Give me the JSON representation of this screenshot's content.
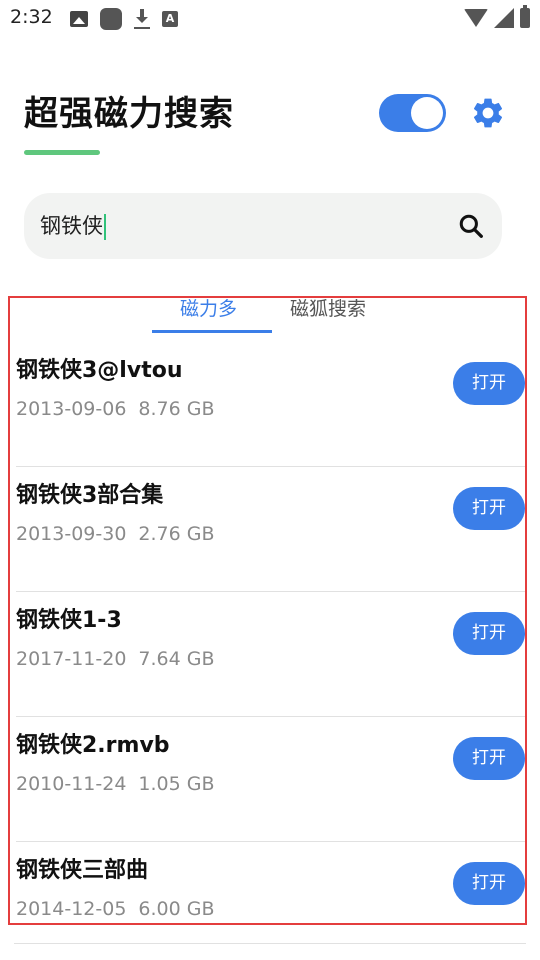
{
  "status_bar": {
    "time": "2:32",
    "left_icons": [
      "image-icon",
      "app-icon",
      "download-icon",
      "a-icon"
    ],
    "right_icons": [
      "wifi-icon",
      "signal-icon",
      "battery-icon"
    ]
  },
  "header": {
    "title": "超强磁力搜索",
    "toggle_on": true,
    "accent_color": "#3b7ee8",
    "underline_color": "#5fc77d"
  },
  "search": {
    "value": "钢铁侠"
  },
  "tabs": [
    {
      "label": "磁力多",
      "active": true
    },
    {
      "label": "磁狐搜索",
      "active": false
    }
  ],
  "results": [
    {
      "title": "钢铁侠3@lvtou",
      "date": "2013-09-06",
      "size": "8.76 GB",
      "button": "打开"
    },
    {
      "title": "钢铁侠3部合集",
      "date": "2013-09-30",
      "size": "2.76 GB",
      "button": "打开"
    },
    {
      "title": "钢铁侠1-3",
      "date": "2017-11-20",
      "size": "7.64 GB",
      "button": "打开"
    },
    {
      "title": "钢铁侠2.rmvb",
      "date": "2010-11-24",
      "size": "1.05 GB",
      "button": "打开"
    },
    {
      "title": "钢铁侠三部曲",
      "date": "2014-12-05",
      "size": "6.00 GB",
      "button": "打开"
    }
  ]
}
